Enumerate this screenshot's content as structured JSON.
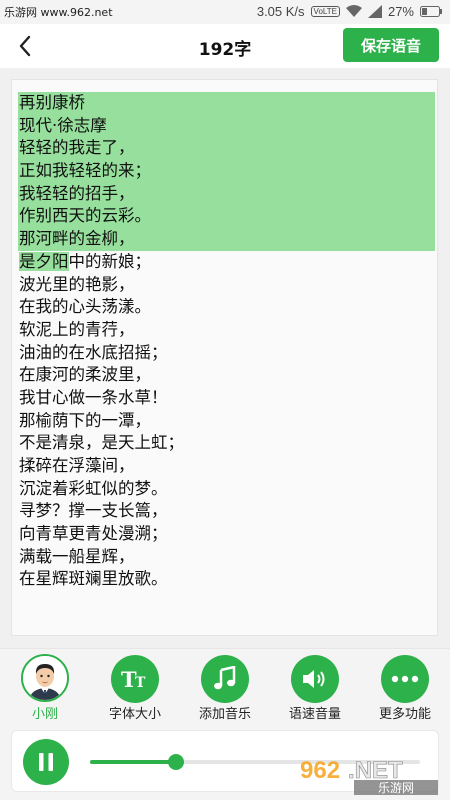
{
  "status_bar": {
    "site_text": "乐游网 www.962.net",
    "speed": "3.05 K/s",
    "volte": "VoLTE",
    "battery": "27%"
  },
  "header": {
    "title": "192字",
    "save_label": "保存语音"
  },
  "poem": {
    "lines": [
      "再别康桥",
      "现代·徐志摩",
      "轻轻的我走了，",
      "正如我轻轻的来；",
      "我轻轻的招手，",
      "作别西天的云彩。",
      "那河畔的金柳，",
      "中的新娘；",
      "波光里的艳影，",
      "在我的心头荡漾。",
      "软泥上的青荇，",
      "油油的在水底招摇；",
      "在康河的柔波里，",
      "我甘心做一条水草！",
      "那榆荫下的一潭，",
      "不是清泉，是天上虹；",
      "揉碎在浮藻间，",
      "沉淀着彩虹似的梦。",
      "寻梦？撑一支长篙，",
      "向青草更青处漫溯；",
      "满载一船星辉，",
      "在星辉斑斓里放歌。"
    ],
    "partial_highlight": "是夕阳",
    "highlight_color": "#96df9c"
  },
  "toolbar": {
    "items": [
      {
        "label": "小刚",
        "icon": "avatar"
      },
      {
        "label": "字体大小",
        "icon": "font-size-icon"
      },
      {
        "label": "添加音乐",
        "icon": "music-note-icon"
      },
      {
        "label": "语速音量",
        "icon": "speaker-icon"
      },
      {
        "label": "更多功能",
        "icon": "more-icon"
      }
    ],
    "accent": "#2db14a"
  },
  "player": {
    "progress": 0.26,
    "state": "playing"
  },
  "watermark": {
    "brand": "962.NET",
    "sub": "乐游网"
  }
}
